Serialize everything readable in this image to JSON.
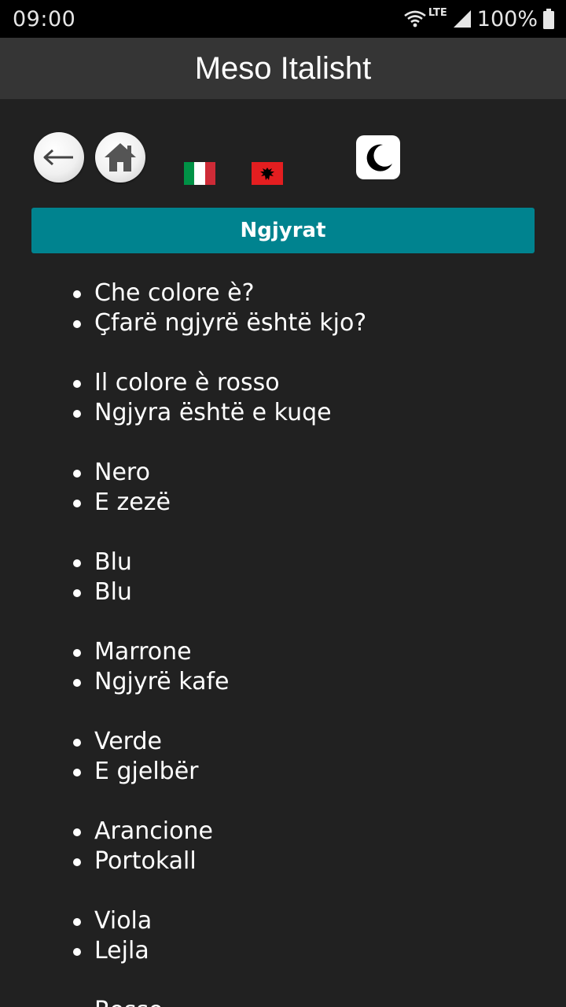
{
  "status_bar": {
    "time": "09:00",
    "network": "LTE",
    "battery": "100%"
  },
  "app_bar": {
    "title": "Meso Italisht"
  },
  "toolbar": {
    "back_icon": "arrow-left-icon",
    "home_icon": "home-icon",
    "flag_source": "italy-flag-icon",
    "flag_target": "albania-flag-icon",
    "night_mode_icon": "crescent-moon-icon"
  },
  "section": {
    "title": "Ngjyrat",
    "color": "#00838f"
  },
  "phrases": [
    {
      "it": "Che colore è?",
      "sq": "Çfarë ngjyrë është kjo?"
    },
    {
      "it": "Il colore è rosso",
      "sq": "Ngjyra është e kuqe"
    },
    {
      "it": "Nero",
      "sq": "E zezë"
    },
    {
      "it": "Blu",
      "sq": "Blu"
    },
    {
      "it": "Marrone",
      "sq": "Ngjyrë kafe"
    },
    {
      "it": "Verde",
      "sq": "E gjelbër"
    },
    {
      "it": "Arancione",
      "sq": "Portokall"
    },
    {
      "it": "Viola",
      "sq": "Lejla"
    },
    {
      "it": "Rosso",
      "sq": ""
    }
  ]
}
